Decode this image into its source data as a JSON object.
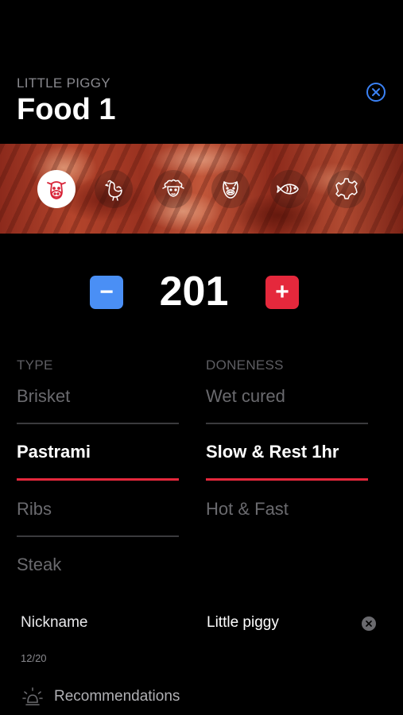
{
  "header": {
    "subtitle": "LITTLE PIGGY",
    "title": "Food 1",
    "close_icon": "close-circle-icon",
    "accent_color": "#3b82f6"
  },
  "food_types": [
    {
      "icon": "cow-icon",
      "selected": true
    },
    {
      "icon": "chicken-icon",
      "selected": false
    },
    {
      "icon": "sheep-icon",
      "selected": false
    },
    {
      "icon": "pig-icon",
      "selected": false
    },
    {
      "icon": "fish-icon",
      "selected": false
    },
    {
      "icon": "custom-gear-icon",
      "selected": false
    }
  ],
  "stepper": {
    "value": "201",
    "minus_label": "−",
    "plus_label": "+",
    "minus_color": "#4a8ff5",
    "plus_color": "#e5283c"
  },
  "type_column": {
    "header": "TYPE",
    "options": [
      "Brisket",
      "Pastrami",
      "Ribs",
      "Steak"
    ],
    "selected": "Pastrami"
  },
  "doneness_column": {
    "header": "DONENESS",
    "options": [
      "Wet cured",
      "Slow & Rest 1hr",
      "Hot & Fast"
    ],
    "selected": "Slow & Rest 1hr"
  },
  "nickname": {
    "label": "Nickname",
    "value": "Little piggy",
    "char_count": "12/20"
  },
  "recommendations": {
    "label": "Recommendations",
    "icon": "lightbulb-icon"
  }
}
